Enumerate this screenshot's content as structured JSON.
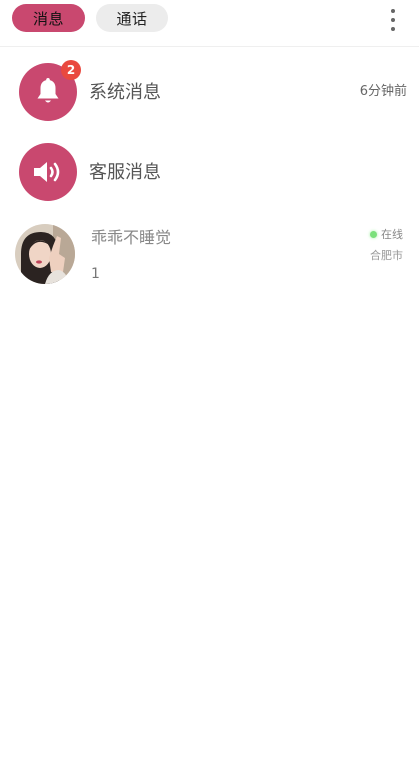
{
  "header": {
    "tabs": [
      {
        "label": "消息",
        "active": true
      },
      {
        "label": "通话",
        "active": false
      }
    ],
    "more_icon": "more-vertical-icon"
  },
  "conversations": {
    "system": {
      "title": "系统消息",
      "badge_count": "2",
      "time": "6分钟前",
      "icon": "bell-icon"
    },
    "service": {
      "title": "客服消息",
      "icon": "speaker-icon"
    },
    "user": {
      "name": "乖乖不睡觉",
      "last_message": "1",
      "status": "在线",
      "city": "合肥市"
    }
  },
  "colors": {
    "accent": "#c9486f",
    "badge": "#e9493f",
    "online": "#7be07b"
  }
}
